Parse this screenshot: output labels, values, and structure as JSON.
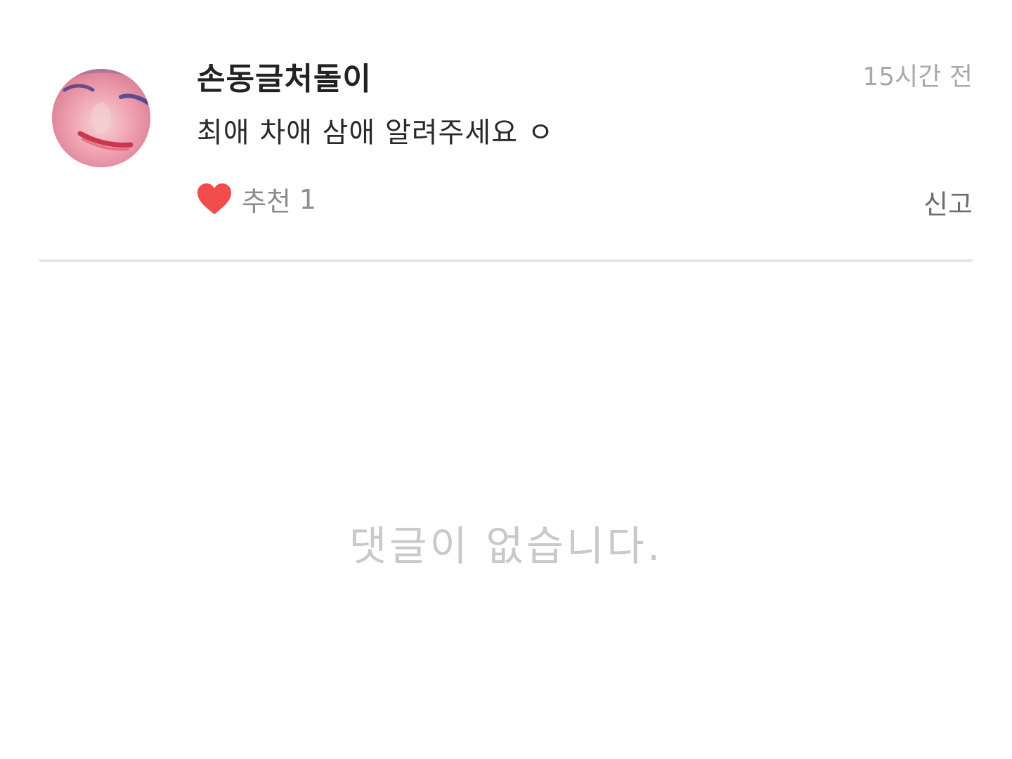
{
  "comment": {
    "author": "손동글처돌이",
    "time": "15시간 전",
    "content": "최애 차애 삼애 알려주세요 ㅇ",
    "like": {
      "label": "추천",
      "count": "1",
      "icon": "heart-icon",
      "color": "#f24c4c"
    },
    "report_label": "신고"
  },
  "empty_state": {
    "message": "댓글이 없습니다."
  }
}
